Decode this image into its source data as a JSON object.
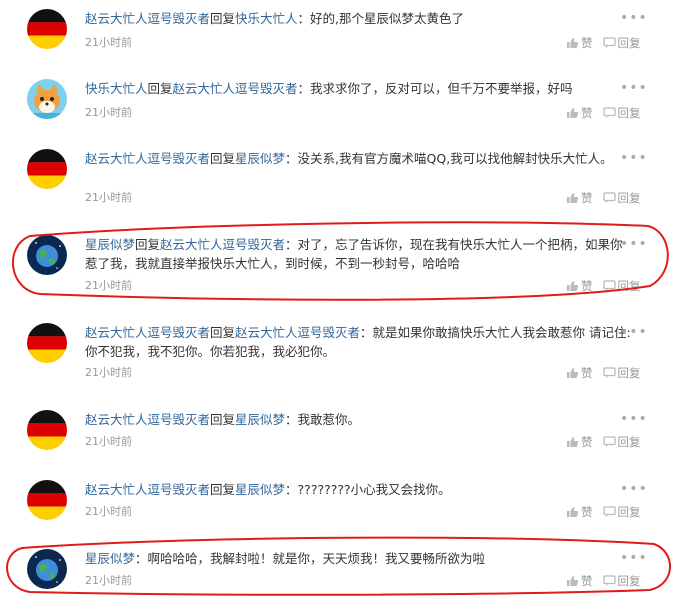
{
  "replies": [
    {
      "avatar": "germany-flag",
      "user": "赵云大忙人逗号毁灭者",
      "reply_word": "回复",
      "target": "快乐大忙人",
      "text": "：好的,那个星辰似梦太黄色了",
      "time": "21小时前"
    },
    {
      "avatar": "cartoon-fox",
      "user": "快乐大忙人",
      "reply_word": "回复",
      "target": "赵云大忙人逗号毁灭者",
      "text": "：我求求你了，反对可以，但千万不要举报，好吗",
      "time": "21小时前"
    },
    {
      "avatar": "germany-flag",
      "user": "赵云大忙人逗号毁灭者",
      "reply_word": "回复",
      "target": "星辰似梦",
      "text": "：没关系,我有官方魔术喵QQ,我可以找他解封快乐大忙人。",
      "time": "21小时前"
    },
    {
      "avatar": "earth-globe",
      "user": "星辰似梦",
      "reply_word": "回复",
      "target": "赵云大忙人逗号毁灭者",
      "text": "：对了，忘了告诉你，现在我有快乐大忙人一个把柄，如果你惹了我，我就直接举报快乐大忙人，到时候，不到一秒封号，哈哈哈",
      "time": "21小时前"
    },
    {
      "avatar": "germany-flag",
      "user": "赵云大忙人逗号毁灭者",
      "reply_word": "回复",
      "target": "赵云大忙人逗号毁灭者",
      "text": "：就是如果你敢搞快乐大忙人我会敢惹你 请记住:你不犯我，我不犯你。你若犯我，我必犯你。",
      "time": "21小时前"
    },
    {
      "avatar": "germany-flag",
      "user": "赵云大忙人逗号毁灭者",
      "reply_word": "回复",
      "target": "星辰似梦",
      "text": "：我敢惹你。",
      "time": "21小时前"
    },
    {
      "avatar": "germany-flag",
      "user": "赵云大忙人逗号毁灭者",
      "reply_word": "回复",
      "target": "星辰似梦",
      "text": "：????????小心我又会找你。",
      "time": "21小时前"
    },
    {
      "avatar": "earth-globe",
      "user": "星辰似梦",
      "reply_word": "",
      "target": "",
      "text": "：啊哈哈哈，我解封啦！就是你，天天烦我！我又要畅所欲为啦",
      "time": "21小时前"
    }
  ],
  "actions": {
    "like": "赞",
    "reply": "回复",
    "more": "•••"
  },
  "colors": {
    "username": "#336699",
    "meta": "#999999",
    "annotation": "#e01b1b"
  }
}
